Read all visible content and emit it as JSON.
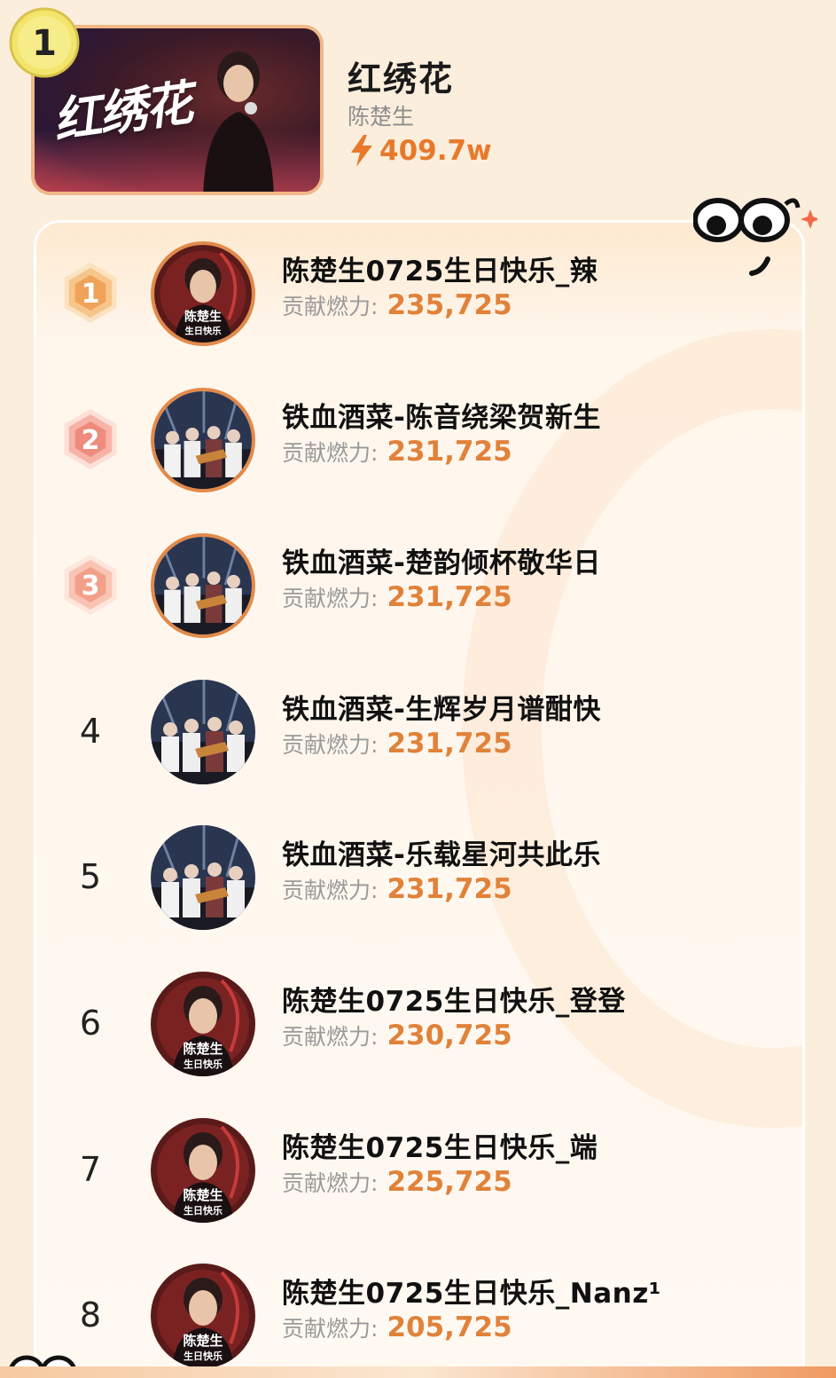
{
  "song": {
    "rank": "1",
    "cover_text": "红绣花",
    "title": "红绣花",
    "artist": "陈楚生",
    "heat": "409.7w"
  },
  "contributors": {
    "score_label": "贡献燃力:",
    "items": [
      {
        "rank": "1",
        "name": "陈楚生0725生日快乐_辣",
        "score": "235,725",
        "avatar": "singer-birthday"
      },
      {
        "rank": "2",
        "name": "铁血酒菜-陈音绕梁贺新生",
        "score": "231,725",
        "avatar": "band-stage"
      },
      {
        "rank": "3",
        "name": "铁血酒菜-楚韵倾杯敬华日",
        "score": "231,725",
        "avatar": "band-stage"
      },
      {
        "rank": "4",
        "name": "铁血酒菜-生辉岁月谱酣快",
        "score": "231,725",
        "avatar": "band-stage"
      },
      {
        "rank": "5",
        "name": "铁血酒菜-乐载星河共此乐",
        "score": "231,725",
        "avatar": "band-stage"
      },
      {
        "rank": "6",
        "name": "陈楚生0725生日快乐_登登",
        "score": "230,725",
        "avatar": "singer-birthday"
      },
      {
        "rank": "7",
        "name": "陈楚生0725生日快乐_端",
        "score": "225,725",
        "avatar": "singer-birthday"
      },
      {
        "rank": "8",
        "name": "陈楚生0725生日快乐_Nanz¹",
        "score": "205,725",
        "avatar": "singer-birthday"
      }
    ]
  },
  "avatar_caption": "陈楚生生日快乐",
  "colors": {
    "accent": "#e0823a",
    "background": "#fbeedd",
    "medal_gold": "#f4b373",
    "medal_red": "#f29a8a",
    "medal_pink": "#f6b3a0"
  }
}
